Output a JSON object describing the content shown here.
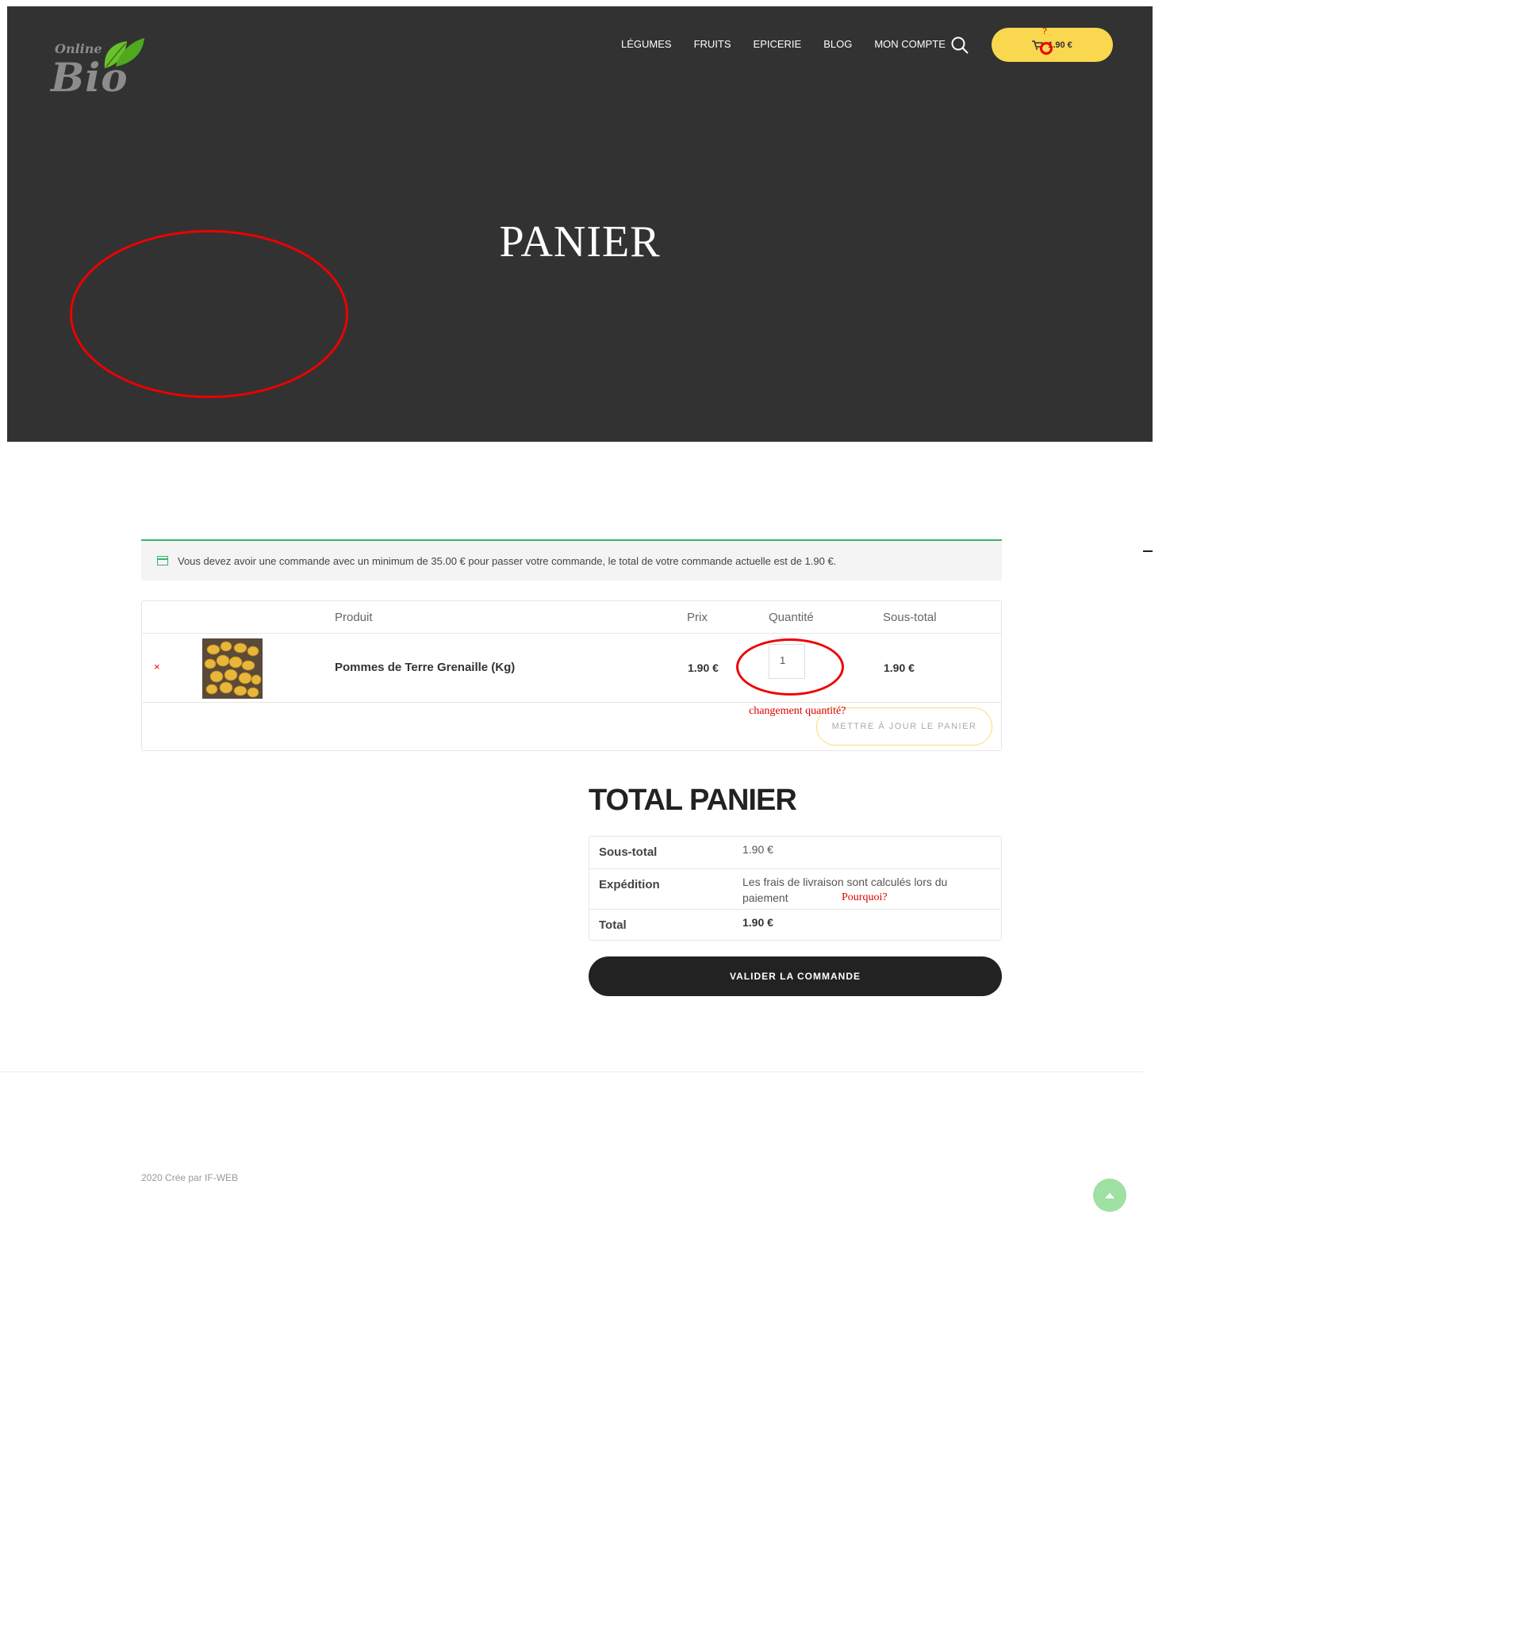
{
  "header": {
    "logo_top": "Online",
    "logo_main": "Bio",
    "nav": [
      "LÉGUMES",
      "FRUITS",
      "EPICERIE",
      "BLOG",
      "MON COMPTE"
    ],
    "cart_amount": "1.90 €",
    "cart_annotation": "?"
  },
  "hero": {
    "title": "PANIER"
  },
  "notice": {
    "text": "Vous devez avoir une commande avec un minimum de 35.00 € pour passer votre commande, le total de votre commande actuelle est de 1.90 €."
  },
  "cart": {
    "headers": {
      "product": "Produit",
      "price": "Prix",
      "quantity": "Quantité",
      "subtotal": "Sous-total"
    },
    "remove": "×",
    "item": {
      "name": "Pommes de Terre Grenaille (Kg)",
      "price": "1.90 €",
      "quantity": "1",
      "subtotal": "1.90 €"
    },
    "qty_annotation": "changement quantité?",
    "update_label": "METTRE À JOUR LE PANIER"
  },
  "totals": {
    "title": "TOTAL PANIER",
    "subtotal_label": "Sous-total",
    "subtotal_value": "1.90 €",
    "shipping_label": "Expédition",
    "shipping_value": "Les frais de livraison sont calculés lors du paiement",
    "shipping_annotation": "Pourquoi?",
    "total_label": "Total",
    "total_value": "1.90 €",
    "checkout_label": "VALIDER LA COMMANDE"
  },
  "footer": {
    "text": "2020 Crée par IF-WEB"
  },
  "colors": {
    "hero_bg": "#323232",
    "cart_btn": "#f9d74f",
    "accent_green": "#3cb371",
    "annotation_red": "#e00000",
    "checkout_bg": "#222222"
  }
}
